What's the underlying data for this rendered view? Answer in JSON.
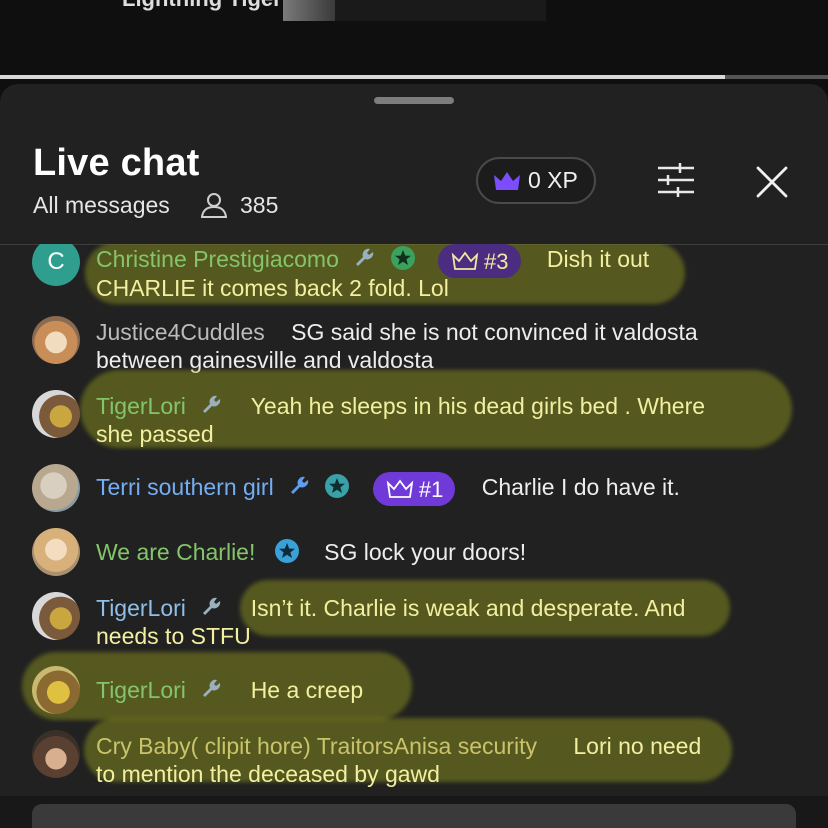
{
  "video": {
    "title": "Lightning Tiger",
    "progress": 0.875
  },
  "chat": {
    "title": "Live chat",
    "filter_label": "All messages",
    "viewer_count": "385",
    "xp_label": "0 XP",
    "icons": {
      "viewers": "person-icon",
      "xp": "crown-icon",
      "filter": "sliders-icon",
      "close": "close-icon"
    },
    "colors": {
      "panel_bg": "#212121",
      "highlight": "#a0a81c",
      "rank_badge": "#6f3ad8",
      "green_name": "#84c46a",
      "blue_name": "#73aef4"
    }
  },
  "messages": [
    {
      "author": "Christine Prestigiacomo",
      "avatar_letter": "C",
      "rank": "#3",
      "line1": "Dish it out",
      "line2": "CHARLIE it comes back 2 fold. Lol"
    },
    {
      "author": "Justice4Cuddles",
      "line1": "SG said she is not convinced it valdosta",
      "line2": "between gainesville and valdosta"
    },
    {
      "author": "TigerLori",
      "line1": "Yeah he sleeps in his dead girls bed . Where",
      "line2": "she passed"
    },
    {
      "author": "Terri southern girl",
      "rank": "#1",
      "line1": "Charlie I do have it."
    },
    {
      "author": "We are Charlie!",
      "line1": "SG lock your doors!"
    },
    {
      "author": "TigerLori",
      "line1": "Isn’t it. Charlie is weak and desperate. And",
      "line2": "needs to STFU"
    },
    {
      "author": "TigerLori",
      "line1": "He a creep"
    },
    {
      "author": "Cry Baby( clipit hore) TraitorsAnisa security",
      "line1": "Lori no need",
      "line2": "to mention the deceased by gawd"
    }
  ]
}
